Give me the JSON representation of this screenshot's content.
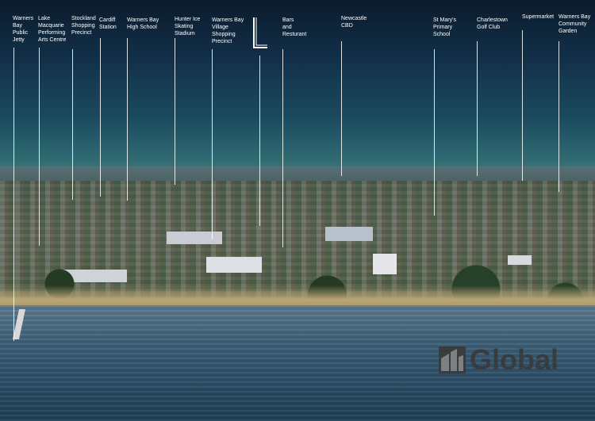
{
  "labels": [
    {
      "text": "Warners\nBay\nPublic\nJetty"
    },
    {
      "text": "Lake\nMacquarie\nPerforming\nArts Centre"
    },
    {
      "text": "Stockland\nShopping\nPrecinct"
    },
    {
      "text": "Cardiff\nStation"
    },
    {
      "text": "Warners Bay\nHigh School"
    },
    {
      "text": "Hunter Ice\nSkating\nStadium"
    },
    {
      "text": "Warners Bay\nVillage\nShopping\nPrecinct"
    },
    {
      "text": "Bars\nand\nResturant"
    },
    {
      "text": "Newcastle\nCBD"
    },
    {
      "text": "St Mary's\nPrimary\nSchool"
    },
    {
      "text": "Charlestown\nGolf Club"
    },
    {
      "text": "Supermarket"
    },
    {
      "text": "Warners Bay\nCommunity\nGarden"
    }
  ],
  "logo": {
    "text": "Global",
    "color": "#3a3a3a"
  },
  "colors": {
    "label": "#ffffff",
    "leader": "#ffffff"
  }
}
